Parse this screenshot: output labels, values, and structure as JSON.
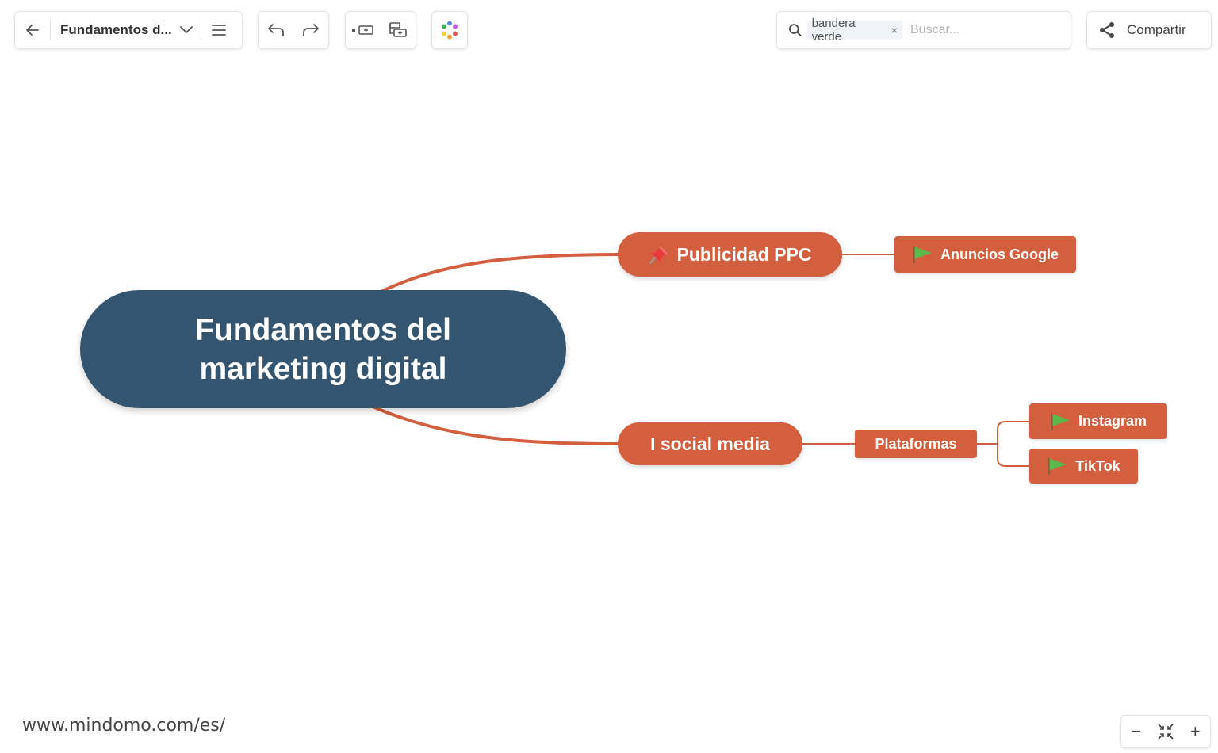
{
  "toolbar": {
    "doc_title": "Fundamentos d...",
    "search": {
      "chip_label": "bandera verde",
      "chip_remove": "×",
      "placeholder": "Buscar..."
    },
    "share_label": "Compartir"
  },
  "map": {
    "root": {
      "line1": "Fundamentos del",
      "line2": "marketing digital",
      "color": "#33556f"
    },
    "topics": [
      {
        "label": "Publicidad PPC",
        "icon": "pin-icon",
        "color": "#d35f3e",
        "children": [
          {
            "label": "Anuncios Google",
            "icon": "green-flag-icon"
          }
        ]
      },
      {
        "label": "I social media",
        "color": "#d35f3e",
        "children": [
          {
            "label": "Plataformas",
            "children": [
              {
                "label": "Instagram",
                "icon": "green-flag-icon"
              },
              {
                "label": "TikTok",
                "icon": "green-flag-icon"
              }
            ]
          }
        ]
      }
    ],
    "connector_color": "#d35f3e"
  },
  "footer": {
    "url": "www.mindomo.com/es/"
  },
  "zoom": {
    "out_label": "−",
    "in_label": "+"
  }
}
